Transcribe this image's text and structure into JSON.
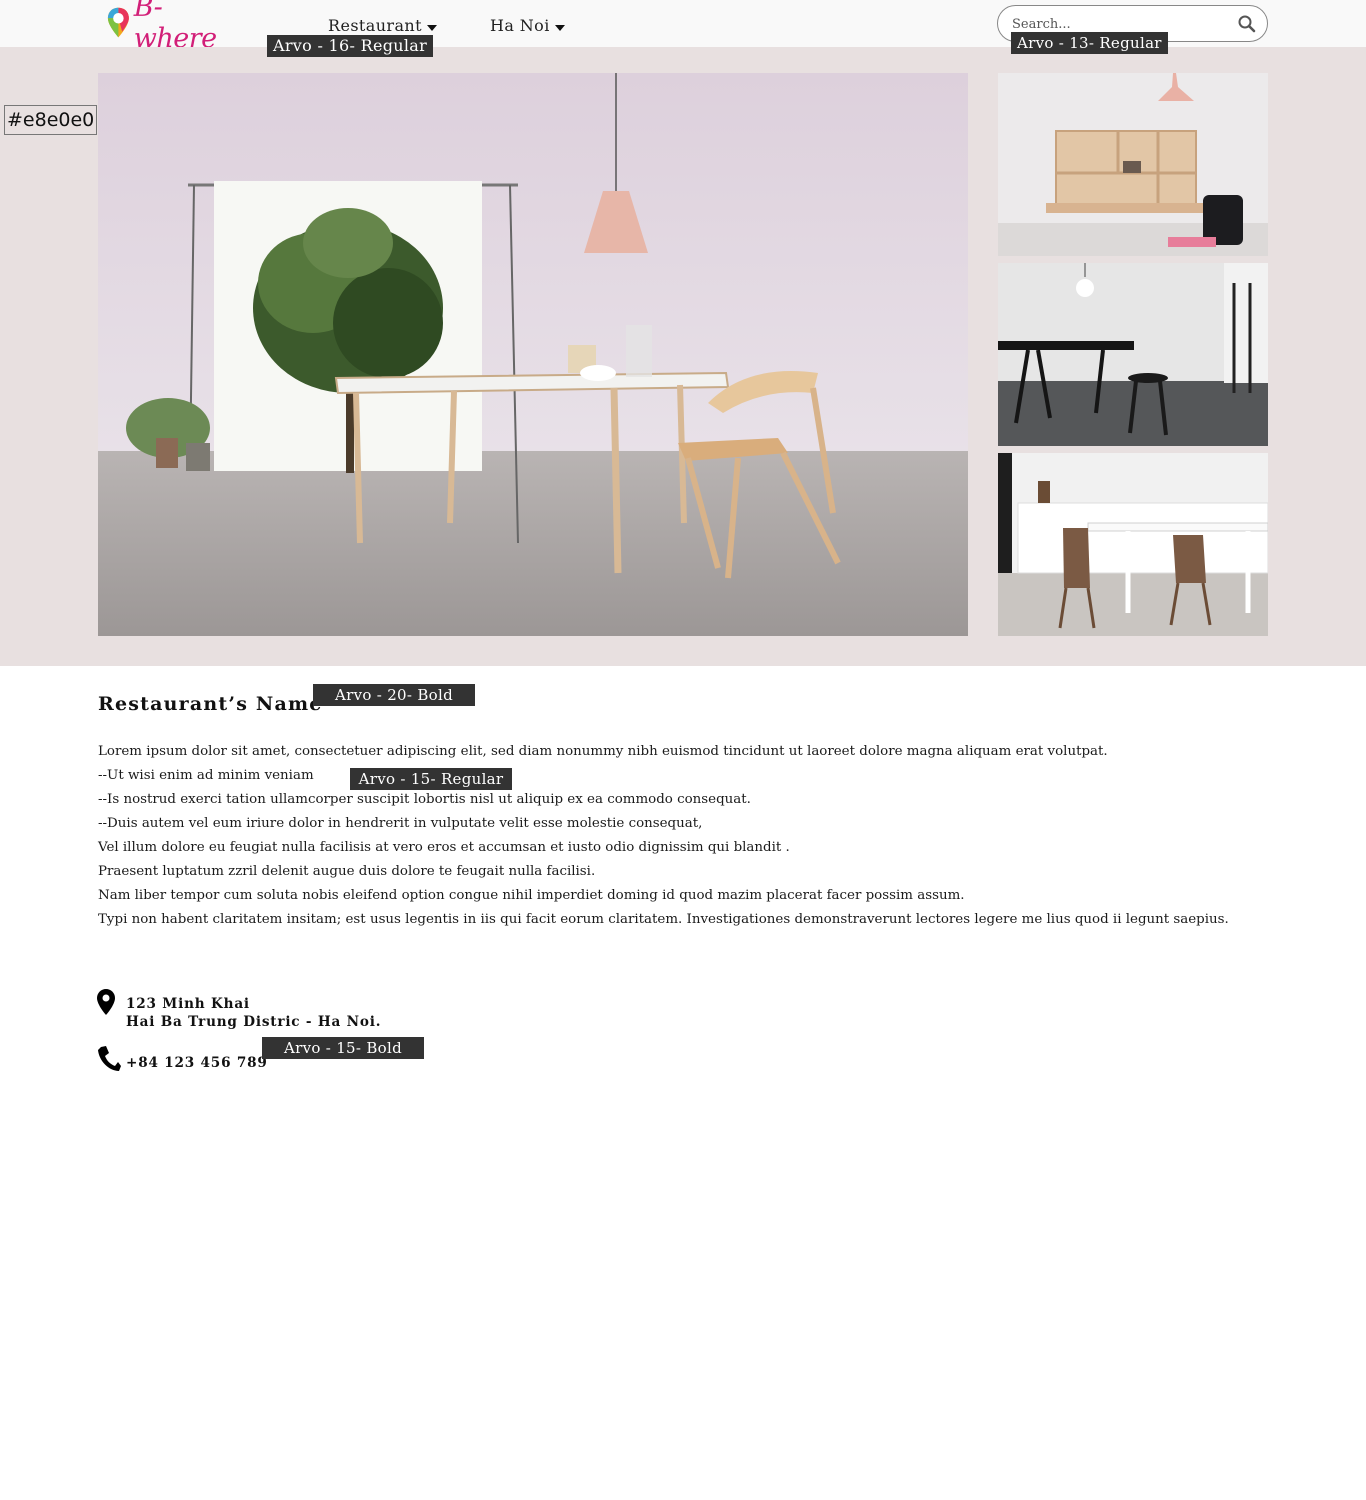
{
  "brand": {
    "name": "B-where",
    "color": "#d21f78"
  },
  "nav": {
    "category": "Restaurant",
    "city": "Ha Noi"
  },
  "search": {
    "placeholder": "Search..."
  },
  "annotations": {
    "background_color": "#e8e0e0",
    "nav_font": "Arvo - 16- Regular",
    "search_font": "Arvo - 13- Regular",
    "title_font": "Arvo - 20- Bold",
    "body_font": "Arvo - 15- Regular",
    "contact_font": "Arvo - 15- Bold"
  },
  "gallery": {
    "main_photo": "dining-table-with-tree-photo",
    "thumbnails": [
      "wall-desk-photo",
      "black-table-photo",
      "white-kitchen-photo"
    ]
  },
  "restaurant": {
    "name": "Restaurant’s Name",
    "description": [
      "Lorem ipsum dolor sit amet, consectetuer adipiscing elit, sed diam nonummy nibh euismod tincidunt ut laoreet dolore magna aliquam erat volutpat.",
      "--Ut wisi enim ad minim veniam",
      "--Is nostrud exerci tation ullamcorper suscipit lobortis nisl ut aliquip ex ea commodo consequat.",
      "--Duis autem vel eum iriure dolor in hendrerit in vulputate velit esse molestie consequat,",
      "Vel illum dolore eu feugiat nulla facilisis at vero eros et accumsan et iusto odio dignissim qui blandit .",
      "Praesent luptatum zzril delenit augue duis dolore te feugait nulla facilisi.",
      "Nam liber tempor cum soluta nobis eleifend option congue nihil imperdiet doming id quod mazim placerat facer possim assum.",
      "Typi non habent claritatem insitam; est usus legentis in iis qui facit eorum claritatem. Investigationes demonstraverunt lectores legere me lius quod ii legunt saepius."
    ],
    "address_line1": "123 Minh Khai",
    "address_line2": "Hai Ba Trung Distric - Ha Noi.",
    "phone": "+84 123 456 789"
  }
}
